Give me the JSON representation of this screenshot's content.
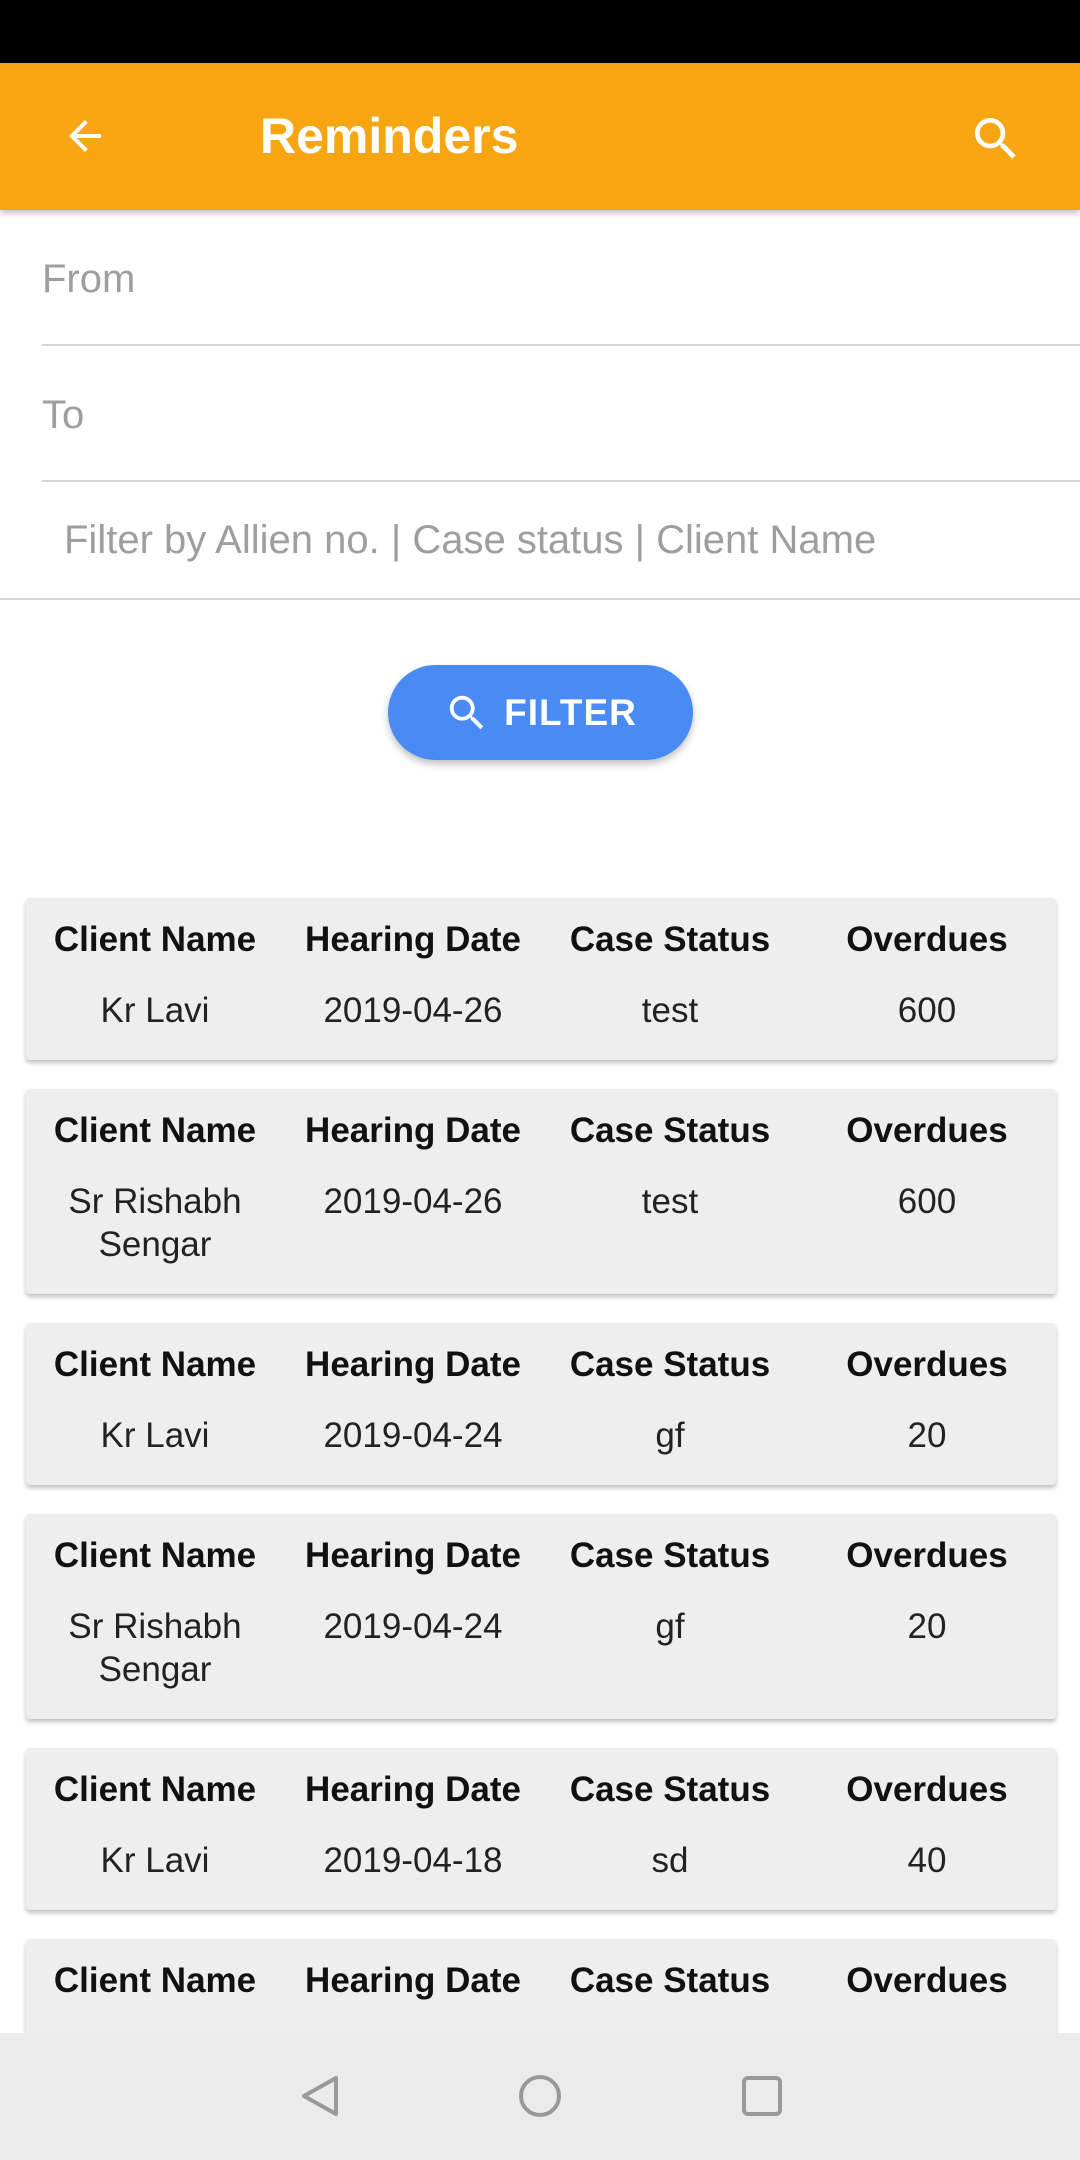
{
  "app_bar": {
    "title": "Reminders"
  },
  "form": {
    "from_placeholder": "From",
    "to_placeholder": "To",
    "filter_placeholder": "Filter by Allien no. | Case status | Client Name",
    "filter_button_label": "FILTER"
  },
  "headers": [
    "Client Name",
    "Hearing Date",
    "Case Status",
    "Overdues"
  ],
  "reminders": [
    {
      "client": "Kr Lavi",
      "date": "2019-04-26",
      "status": "test",
      "overdues": "600"
    },
    {
      "client": "Sr Rishabh Sengar",
      "date": "2019-04-26",
      "status": "test",
      "overdues": "600"
    },
    {
      "client": "Kr Lavi",
      "date": "2019-04-24",
      "status": "gf",
      "overdues": "20"
    },
    {
      "client": "Sr Rishabh Sengar",
      "date": "2019-04-24",
      "status": "gf",
      "overdues": "20"
    },
    {
      "client": "Kr Lavi",
      "date": "2019-04-18",
      "status": "sd",
      "overdues": "40"
    },
    {
      "client": "",
      "date": "",
      "status": "",
      "overdues": ""
    }
  ],
  "colors": {
    "app_bar": "#F7A511",
    "button": "#4A8AF4",
    "card": "#EEEEEE"
  },
  "icons": [
    "back-arrow-icon",
    "search-icon",
    "nav-back-icon",
    "nav-home-icon",
    "nav-recents-icon"
  ]
}
